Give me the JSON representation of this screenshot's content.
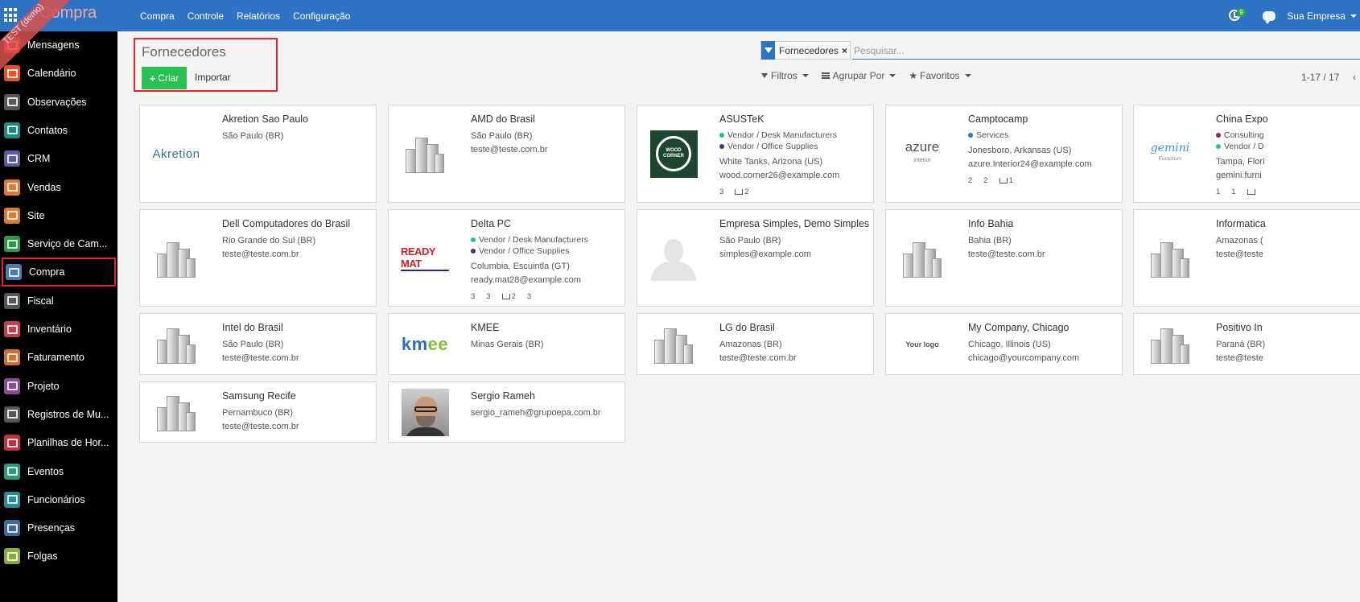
{
  "app": {
    "brand": "Compra",
    "ribbon": "TEST (demo)"
  },
  "top_menu": [
    "Compra",
    "Controle",
    "Relatórios",
    "Configuração"
  ],
  "top_right": {
    "activity_count": "9",
    "company": "Sua Empresa"
  },
  "sidebar": [
    {
      "label": "Mensagens",
      "color": "#e8252c"
    },
    {
      "label": "Calendário",
      "color": "#e8502c"
    },
    {
      "label": "Observações",
      "color": "#555555"
    },
    {
      "label": "Contatos",
      "color": "#1a8a7a"
    },
    {
      "label": "CRM",
      "color": "#5a5aa5"
    },
    {
      "label": "Vendas",
      "color": "#e07a30"
    },
    {
      "label": "Site",
      "color": "#e07a30"
    },
    {
      "label": "Serviço de Cam...",
      "color": "#2a9a4a"
    },
    {
      "label": "Compra",
      "color": "#4a7ab5"
    },
    {
      "label": "Fiscal",
      "color": "#555555"
    },
    {
      "label": "Inventário",
      "color": "#c04050"
    },
    {
      "label": "Faturamento",
      "color": "#d07030"
    },
    {
      "label": "Projeto",
      "color": "#8a4a9a"
    },
    {
      "label": "Registros de Mu...",
      "color": "#555555"
    },
    {
      "label": "Planilhas de Hor...",
      "color": "#c03040"
    },
    {
      "label": "Eventos",
      "color": "#2a9a7a"
    },
    {
      "label": "Funcionários",
      "color": "#2a8a9a"
    },
    {
      "label": "Presenças",
      "color": "#3a6a9a"
    },
    {
      "label": "Folgas",
      "color": "#8aaa3a"
    }
  ],
  "control_panel": {
    "title": "Fornecedores",
    "create_label": "Criar",
    "import_label": "Importar",
    "facet_label": "Fornecedores",
    "search_placeholder": "Pesquisar...",
    "filters_label": "Filtros",
    "group_by_label": "Agrupar Por",
    "favorites_label": "Favoritos",
    "pager": "1-17 / 17"
  },
  "cards": [
    {
      "name": "Akretion Sao Paulo",
      "logo": "akretion",
      "logo_text": "Akretion",
      "tags": [],
      "lines": [
        "São Paulo (BR)"
      ],
      "counters": []
    },
    {
      "name": "AMD do Brasil",
      "logo": "building",
      "tags": [],
      "lines": [
        "São Paulo (BR)",
        "teste@teste.com.br"
      ],
      "counters": []
    },
    {
      "name": "ASUSTeK",
      "logo": "wood",
      "logo_text": "WOOD CORNER",
      "tags": [
        {
          "label": "Vendor / Desk Manufacturers",
          "color": "#28c090"
        },
        {
          "label": "Vendor / Office Supplies",
          "color": "#3a3a7a"
        }
      ],
      "lines": [
        "White Tanks, Arizona (US)",
        "wood.corner26@example.com"
      ],
      "counters": [
        {
          "v": "3"
        },
        {
          "v": "2",
          "cart": true
        }
      ]
    },
    {
      "name": "Camptocamp",
      "logo": "azure",
      "logo_text": "azure",
      "logo_sub": "interior",
      "tags": [
        {
          "label": "Services",
          "color": "#2f74c4"
        }
      ],
      "lines": [
        "Jonesboro, Arkansas (US)",
        "azure.Interior24@example.com"
      ],
      "counters": [
        {
          "v": "2"
        },
        {
          "v": "2"
        },
        {
          "v": "1",
          "cart": true
        }
      ]
    },
    {
      "name": "China Expo",
      "logo": "gemini",
      "logo_text": "gemini",
      "logo_sub": "Furniture",
      "tags": [
        {
          "label": "Consulting",
          "color": "#8a2a4a"
        },
        {
          "label": "Vendor / D",
          "color": "#28c090"
        }
      ],
      "lines": [
        "Tampa, Flori",
        "gemini.furni"
      ],
      "counters": [
        {
          "v": "1"
        },
        {
          "v": "1"
        },
        {
          "v": "",
          "cart": true
        }
      ]
    },
    {
      "name": "Dell Computadores do Brasil",
      "logo": "building",
      "tags": [],
      "lines": [
        "Rio Grande do Sul (BR)",
        "teste@teste.com.br"
      ],
      "counters": []
    },
    {
      "name": "Delta PC",
      "logo": "readymat",
      "logo_text": "READY MAT",
      "tags": [
        {
          "label": "Vendor / Desk Manufacturers",
          "color": "#28c090"
        },
        {
          "label": "Vendor / Office Supplies",
          "color": "#3a3a7a"
        }
      ],
      "lines": [
        "Columbia, Escuintla (GT)",
        "ready.mat28@example.com"
      ],
      "counters": [
        {
          "v": "3"
        },
        {
          "v": "3"
        },
        {
          "v": "2",
          "cart": true
        },
        {
          "v": "3"
        }
      ]
    },
    {
      "name": "Empresa Simples, Demo Simples",
      "logo": "avatar",
      "tags": [],
      "lines": [
        "São Paulo (BR)",
        "simples@example.com"
      ],
      "counters": []
    },
    {
      "name": "Info Bahia",
      "logo": "building",
      "tags": [],
      "lines": [
        "Bahia (BR)",
        "teste@teste.com.br"
      ],
      "counters": []
    },
    {
      "name": "Informatica",
      "logo": "building",
      "tags": [],
      "lines": [
        "Amazonas (",
        "teste@teste"
      ],
      "counters": []
    },
    {
      "name": "Intel do Brasil",
      "logo": "building",
      "tags": [],
      "lines": [
        "São Paulo (BR)",
        "teste@teste.com.br"
      ],
      "counters": []
    },
    {
      "name": "KMEE",
      "logo": "kmee",
      "logo_text": "km",
      "logo_text2": "ee",
      "tags": [],
      "lines": [
        "Minas Gerais (BR)"
      ],
      "counters": []
    },
    {
      "name": "LG do Brasil",
      "logo": "building",
      "tags": [],
      "lines": [
        "Amazonas (BR)",
        "teste@teste.com.br"
      ],
      "counters": []
    },
    {
      "name": "My Company, Chicago",
      "logo": "yourlogo",
      "logo_text": "Your logo",
      "tags": [],
      "lines": [
        "Chicago, Illinois (US)",
        "chicago@yourcompany.com"
      ],
      "counters": []
    },
    {
      "name": "Positivo In",
      "logo": "building",
      "tags": [],
      "lines": [
        "Paraná (BR)",
        "teste@teste"
      ],
      "counters": []
    },
    {
      "name": "Samsung Recife",
      "logo": "building",
      "tags": [],
      "lines": [
        "Pernambuco (BR)",
        "teste@teste.com.br"
      ],
      "counters": []
    },
    {
      "name": "Sergio Rameh",
      "logo": "photo",
      "tags": [],
      "lines": [
        "sergio_rameh@grupoepa.com.br"
      ],
      "counters": []
    }
  ]
}
